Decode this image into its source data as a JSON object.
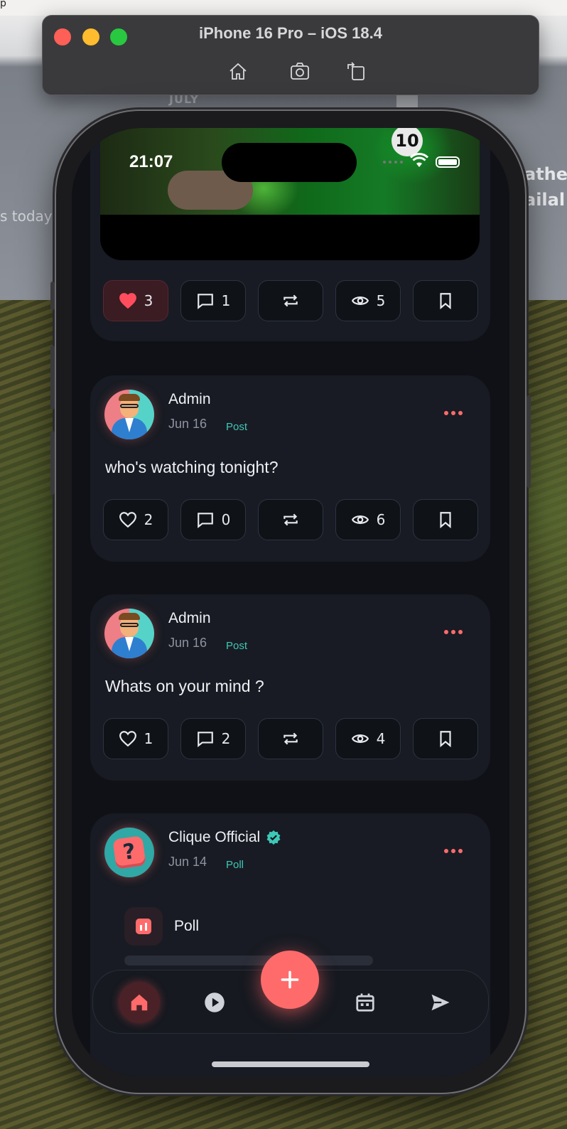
{
  "desktop": {
    "corner_glyph": "p",
    "month": "JULY",
    "left_text": "s today",
    "right_text_line1": "athe",
    "right_text_line2": "ailal"
  },
  "simulator": {
    "title": "iPhone 16 Pro – iOS 18.4",
    "tools": [
      "home-icon",
      "screenshot-icon",
      "rotate-icon"
    ]
  },
  "status_bar": {
    "time": "21:07"
  },
  "media_post": {
    "jersey_number": "10",
    "actions": {
      "likes": "3",
      "comments": "1",
      "views": "5"
    }
  },
  "posts": [
    {
      "author": "Admin",
      "date": "Jun 16",
      "type": "Post",
      "text": "who's watching tonight?",
      "actions": {
        "likes": "2",
        "comments": "0",
        "views": "6"
      }
    },
    {
      "author": "Admin",
      "date": "Jun 16",
      "type": "Post",
      "text": "Whats on your mind ?",
      "actions": {
        "likes": "1",
        "comments": "2",
        "views": "4"
      }
    }
  ],
  "poll_post": {
    "author": "Clique Official",
    "verified": true,
    "date": "Jun 14",
    "type": "Poll",
    "poll_label": "Poll",
    "avatar_glyph": "?"
  },
  "bottom_nav": {
    "items": [
      "home-icon",
      "play-icon",
      "add-icon",
      "calendar-icon",
      "send-icon"
    ],
    "active": "home"
  },
  "colors": {
    "accent": "#ff6b6b",
    "teal": "#3ec7b7",
    "card": "#181b23",
    "screen_bg": "#0f1116"
  }
}
